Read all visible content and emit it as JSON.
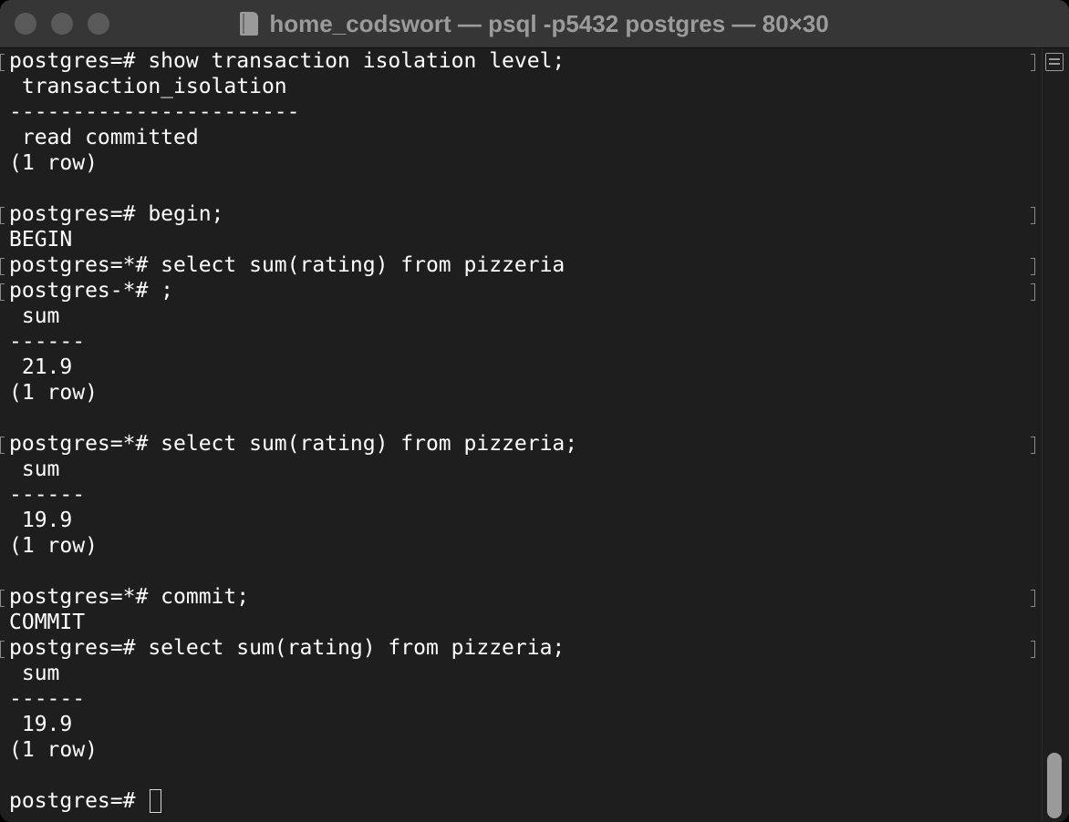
{
  "window": {
    "title": "home_codswort — psql -p5432 postgres — 80×30"
  },
  "terminal": {
    "lines": [
      {
        "text": "postgres=# show transaction isolation level;",
        "marked": true
      },
      {
        "text": " transaction_isolation",
        "marked": false
      },
      {
        "text": "-----------------------",
        "marked": false
      },
      {
        "text": " read committed",
        "marked": false
      },
      {
        "text": "(1 row)",
        "marked": false
      },
      {
        "text": "",
        "marked": false
      },
      {
        "text": "postgres=# begin;",
        "marked": true
      },
      {
        "text": "BEGIN",
        "marked": false
      },
      {
        "text": "postgres=*# select sum(rating) from pizzeria",
        "marked": true
      },
      {
        "text": "postgres-*# ;",
        "marked": true
      },
      {
        "text": " sum",
        "marked": false
      },
      {
        "text": "------",
        "marked": false
      },
      {
        "text": " 21.9",
        "marked": false
      },
      {
        "text": "(1 row)",
        "marked": false
      },
      {
        "text": "",
        "marked": false
      },
      {
        "text": "postgres=*# select sum(rating) from pizzeria;",
        "marked": true
      },
      {
        "text": " sum",
        "marked": false
      },
      {
        "text": "------",
        "marked": false
      },
      {
        "text": " 19.9",
        "marked": false
      },
      {
        "text": "(1 row)",
        "marked": false
      },
      {
        "text": "",
        "marked": false
      },
      {
        "text": "postgres=*# commit;",
        "marked": true
      },
      {
        "text": "COMMIT",
        "marked": false
      },
      {
        "text": "postgres=# select sum(rating) from pizzeria;",
        "marked": true
      },
      {
        "text": " sum",
        "marked": false
      },
      {
        "text": "------",
        "marked": false
      },
      {
        "text": " 19.9",
        "marked": false
      },
      {
        "text": "(1 row)",
        "marked": false
      },
      {
        "text": "",
        "marked": false
      }
    ],
    "prompt": "postgres=# "
  },
  "icons": {
    "window_controls": [
      "close-button-icon",
      "minimize-button-icon",
      "zoom-button-icon"
    ],
    "title_icon": "terminal-document-icon",
    "split_icon": "split-pane-icon"
  },
  "colors": {
    "background": "#1e1e1e",
    "text": "#ffffff",
    "titlebar": "#363636"
  }
}
